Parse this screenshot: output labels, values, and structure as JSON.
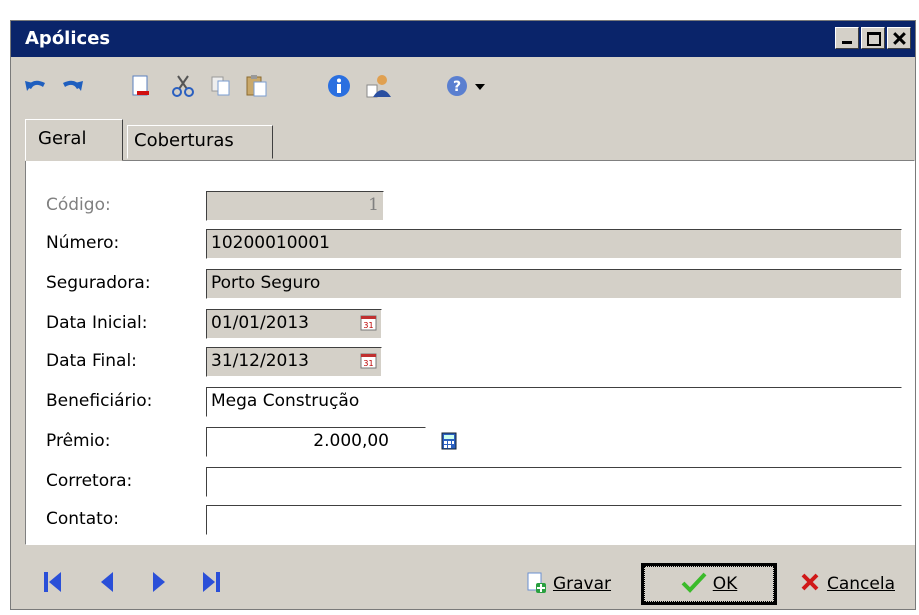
{
  "window": {
    "title": "Apólices"
  },
  "toolbar": {
    "items": [
      "undo-icon",
      "redo-icon",
      "new-document-icon",
      "cut-icon",
      "copy-icon",
      "paste-icon",
      "info-icon",
      "user-document-icon",
      "help-icon",
      "dropdown-arrow-icon"
    ]
  },
  "tabs": [
    {
      "label": "Geral",
      "active": true
    },
    {
      "label": "Coberturas",
      "active": false
    }
  ],
  "form": {
    "codigo": {
      "label": "Código:",
      "value": "1"
    },
    "numero": {
      "label": "Número:",
      "value": "10200010001"
    },
    "seguradora": {
      "label": "Seguradora:",
      "value": "Porto Seguro"
    },
    "data_inicial": {
      "label": "Data Inicial:",
      "value": "01/01/2013"
    },
    "data_final": {
      "label": "Data Final:",
      "value": "31/12/2013"
    },
    "beneficiario": {
      "label": "Beneficiário:",
      "value": "Mega Construção"
    },
    "premio": {
      "label": "Prêmio:",
      "value": "2.000,00"
    },
    "corretora": {
      "label": "Corretora:",
      "value": ""
    },
    "contato": {
      "label": "Contato:",
      "value": ""
    }
  },
  "buttons": {
    "gravar": "Gravar",
    "ok": "OK",
    "cancela": "Cancela"
  },
  "colors": {
    "title_bar": "#0a246a",
    "window_bg": "#d4d0c8",
    "nav_blue": "#2a4fd8"
  }
}
